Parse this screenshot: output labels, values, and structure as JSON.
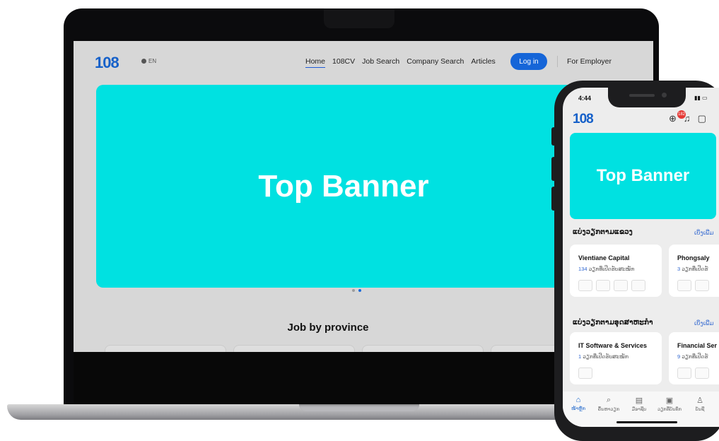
{
  "desktop": {
    "logo": "108",
    "language": "EN",
    "nav": [
      "Home",
      "108CV",
      "Job Search",
      "Company Search",
      "Articles"
    ],
    "login": "Log in",
    "employer": "For Employer",
    "banner": "Top Banner",
    "section_title": "Job by province"
  },
  "mobile": {
    "time": "4:44",
    "logo": "108",
    "notification_count": "182",
    "banner": "Top Banner",
    "section1": {
      "title": "ແບ່ງວຽກຕາມແຂວງ",
      "more": "ເບິ່ງເພີ່ມ"
    },
    "province_cards": [
      {
        "title": "Vientiane Capital",
        "count": "134",
        "suffix": "ວຽກທີ່ເປີດຮັບສະໝັກ"
      },
      {
        "title": "Phongsaly",
        "count": "3",
        "suffix": "ວຽກທີ່ເປີດຮັ"
      }
    ],
    "section2": {
      "title": "ແບ່ງວຽກຕາມອຸດສາຫະກຳ",
      "more": "ເບິ່ງເພີ່ມ"
    },
    "industry_cards": [
      {
        "title": "IT Software & Services",
        "count": "1",
        "suffix": "ວຽກທີ່ເປີດຮັບສະໝັກ"
      },
      {
        "title": "Financial Ser",
        "count": "9",
        "suffix": "ວຽກທີ່ເປີດຮັ"
      }
    ],
    "tabs": [
      "ໜ້າຫຼັກ",
      "ຄົ້ນຫາວຽກ",
      "ມືອາຊີບ",
      "ວຽກທີ່ບັນທຶກ",
      "ບັນຊີ"
    ],
    "icons": [
      "home-icon",
      "search-icon",
      "document-icon",
      "briefcase-icon",
      "user-icon"
    ]
  },
  "colors": {
    "brand": "#1560c9",
    "banner": "#00e1e1",
    "login": "#1565d8"
  }
}
